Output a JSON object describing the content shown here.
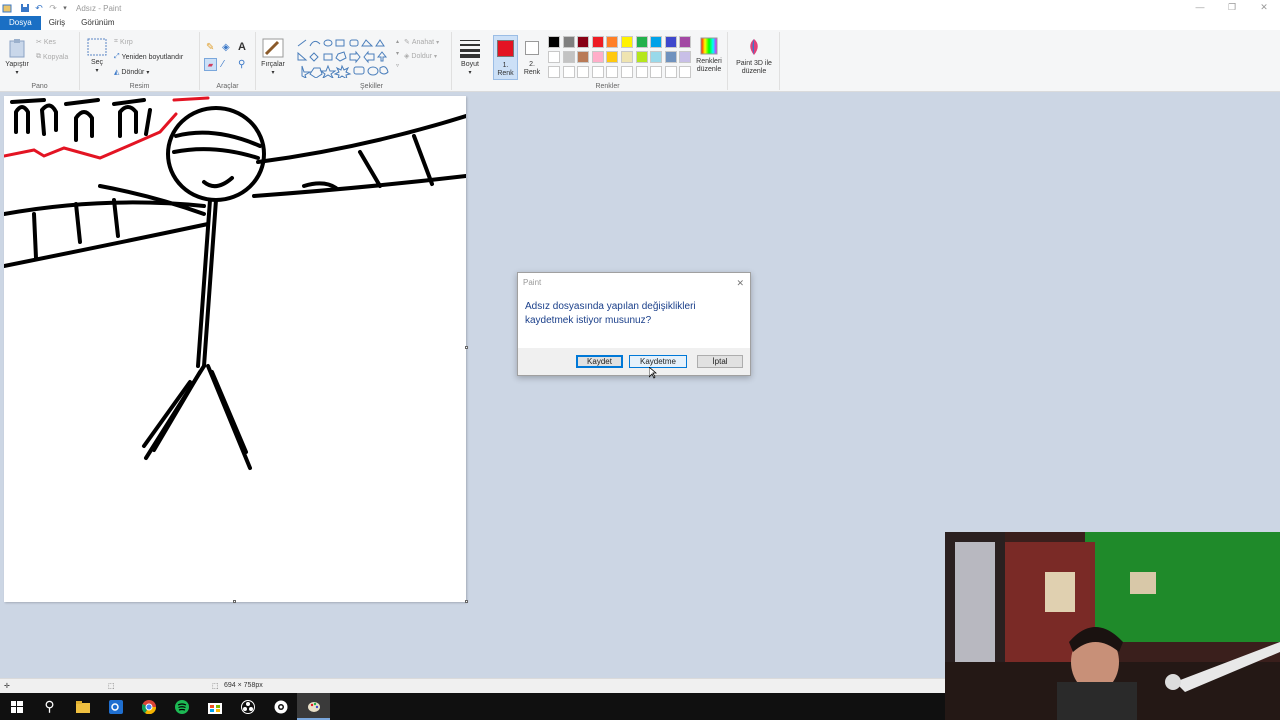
{
  "window": {
    "title": "Adsız - Paint",
    "minimize_glyph": "—",
    "restore_glyph": "❐",
    "close_glyph": "✕"
  },
  "menu": {
    "tabs": [
      "Dosya",
      "Giriş",
      "Görünüm"
    ]
  },
  "ribbon": {
    "clipboard": {
      "paste_label": "Yapıştır",
      "cut_label": "Kes",
      "copy_label": "Kopyala",
      "group_label": "Pano"
    },
    "image": {
      "select_label": "Seç",
      "crop_label": "Kırp",
      "resize_label": "Yeniden boyutlandır",
      "rotate_label": "Döndür",
      "group_label": "Resim"
    },
    "tools": {
      "group_label": "Araçlar"
    },
    "brushes": {
      "label": "Fırçalar"
    },
    "shapes": {
      "outline_label": "Anahat",
      "fill_label": "Doldur",
      "group_label": "Şekiller"
    },
    "size": {
      "label": "Boyut"
    },
    "colors": {
      "color1_label": "1.\nRenk",
      "color1_l1": "1.",
      "color1_l2": "Renk",
      "color2_l1": "2.",
      "color2_l2": "Renk",
      "edit_colors_l1": "Renkleri",
      "edit_colors_l2": "düzenle",
      "group_label": "Renkler",
      "color1": "#e31423",
      "color2": "#ffffff",
      "palette_row1": [
        "#000000",
        "#7f7f7f",
        "#880015",
        "#ed1c24",
        "#ff7f27",
        "#fff200",
        "#22b14c",
        "#00a2e8",
        "#3f48cc",
        "#a349a4"
      ],
      "palette_row2": [
        "#ffffff",
        "#c3c3c3",
        "#b97a57",
        "#ffaec9",
        "#ffc90e",
        "#efe4b0",
        "#b5e61d",
        "#99d9ea",
        "#7092be",
        "#c8bfe7"
      ]
    },
    "paint3d": {
      "l1": "Paint 3D ile",
      "l2": "düzenle"
    }
  },
  "dialog": {
    "title": "Paint",
    "close_glyph": "✕",
    "message_l1": "Adsız dosyasında yapılan değişiklikleri",
    "message_l2": "kaydetmek istiyor musunuz?",
    "save_label": "Kaydet",
    "dont_save_label": "Kaydetme",
    "cancel_label": "İptal"
  },
  "statusbar": {
    "dimensions": "694 × 758px"
  }
}
